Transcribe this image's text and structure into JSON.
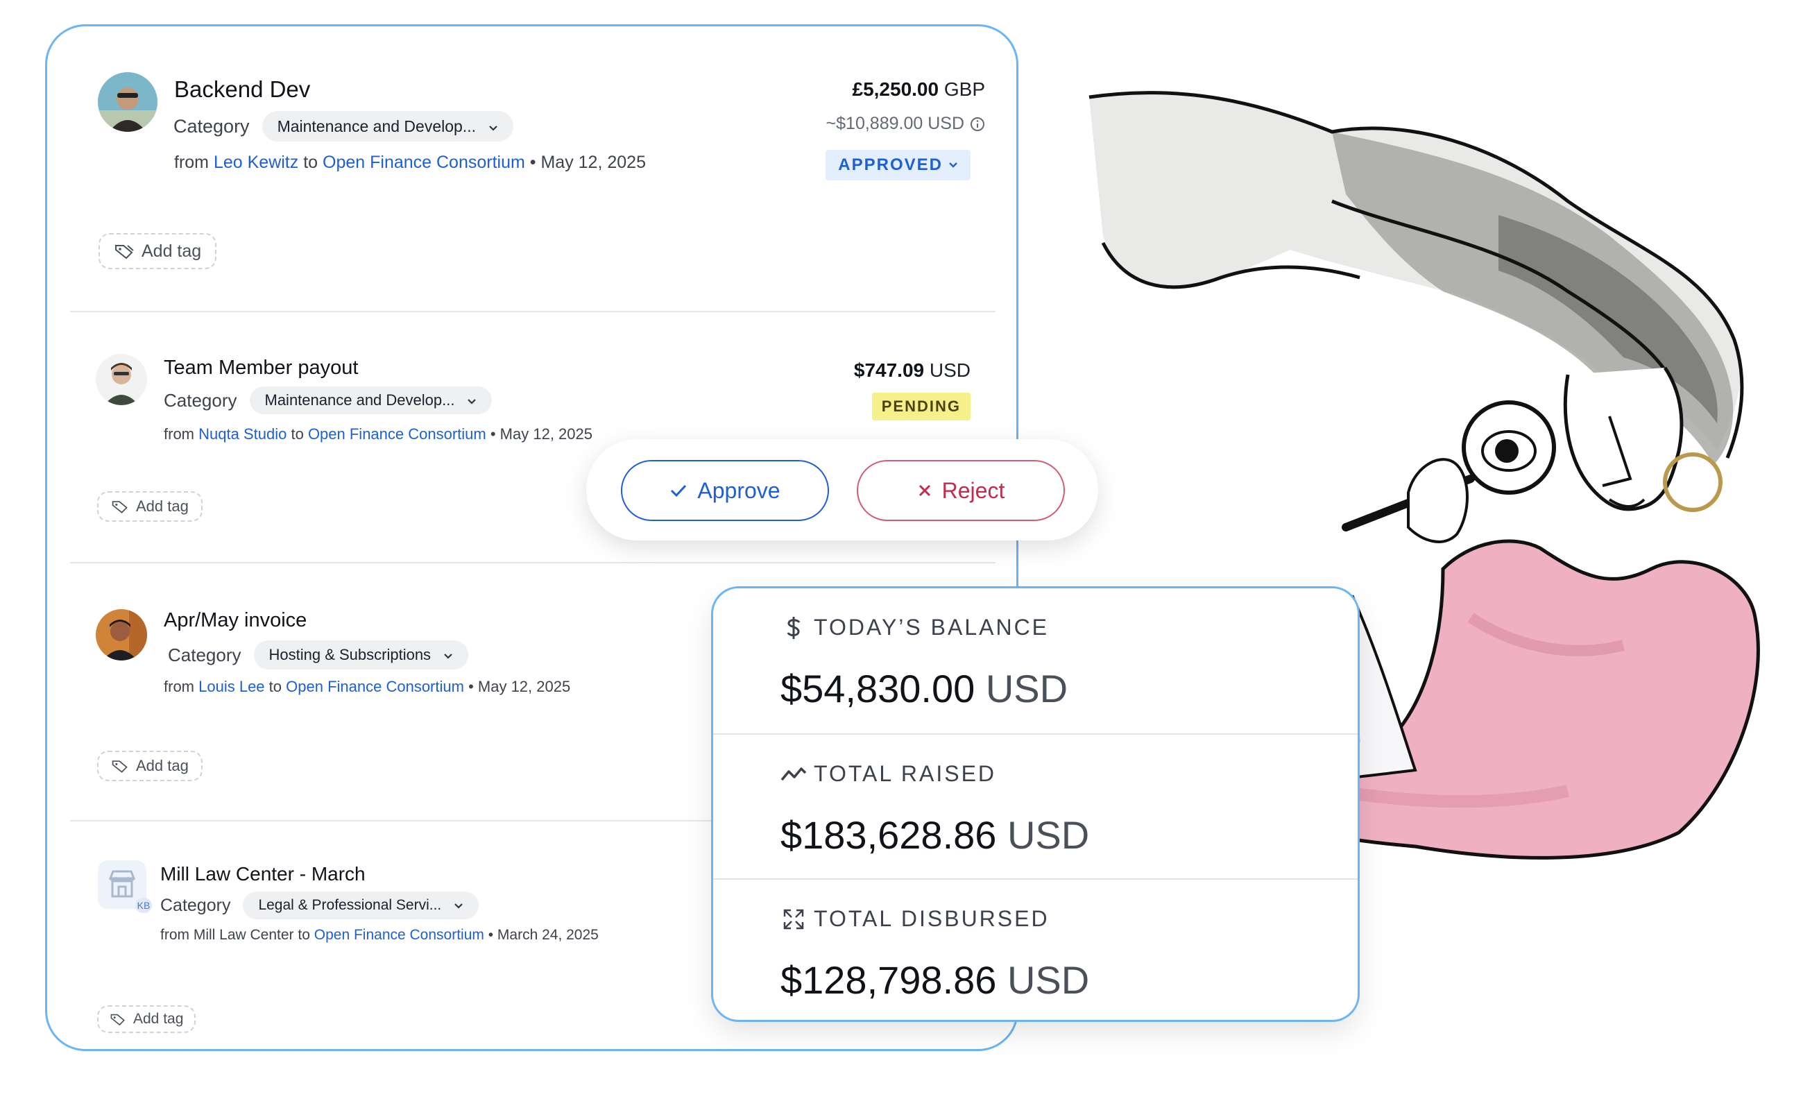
{
  "expenses": [
    {
      "title": "Backend Dev",
      "category_label": "Category",
      "category": "Maintenance and Develop...",
      "from_word": "from",
      "from": "Leo Kewitz",
      "to_word": "to",
      "to": "Open Finance Consortium",
      "date": "• May 12, 2025",
      "amount": "£5,250.00",
      "currency": "GBP",
      "converted": "~$10,889.00 USD",
      "status": "APPROVED",
      "add_tag": "Add tag"
    },
    {
      "title": "Team Member payout",
      "category_label": "Category",
      "category": "Maintenance and Develop...",
      "from_word": "from",
      "from": "Nuqta Studio",
      "to_word": "to",
      "to": "Open Finance Consortium",
      "date": "• May 12, 2025",
      "amount": "$747.09",
      "currency": "USD",
      "status": "PENDING",
      "add_tag": "Add tag"
    },
    {
      "title": "Apr/May invoice",
      "category_label": "Category",
      "category": "Hosting & Subscriptions",
      "from_word": "from",
      "from": "Louis Lee",
      "to_word": "to",
      "to": "Open Finance Consortium",
      "date": "• May 12, 2025",
      "add_tag": "Add tag"
    },
    {
      "title": "Mill Law Center - March",
      "category_label": "Category",
      "category": "Legal & Professional Servi...",
      "from_word": "from Mill Law Center",
      "to_word": "to",
      "to": "Open Finance Consortium",
      "date": "• March 24, 2025",
      "avatar_badge": "KB",
      "add_tag": "Add tag"
    }
  ],
  "actions": {
    "approve": "Approve",
    "reject": "Reject"
  },
  "balance": {
    "today": {
      "label": "TODAY’S BALANCE",
      "amount": "$54,830.00",
      "currency": "USD"
    },
    "raised": {
      "label": "TOTAL RAISED",
      "amount": "$183,628.86",
      "currency": "USD"
    },
    "disbursed": {
      "label": "TOTAL DISBURSED",
      "amount": "$128,798.86",
      "currency": "USD"
    }
  },
  "colors": {
    "accent_blue": "#1d5fd6",
    "card_border": "#6cb4f3",
    "approved_bg": "#e3effc",
    "pending_bg": "#f6f08a",
    "reject_red": "#c42a4c"
  },
  "icons": [
    "tag-icon",
    "chevron-down-icon",
    "check-icon",
    "close-icon",
    "dollar-icon",
    "trend-icon",
    "expand-arrows-icon",
    "store-icon"
  ]
}
